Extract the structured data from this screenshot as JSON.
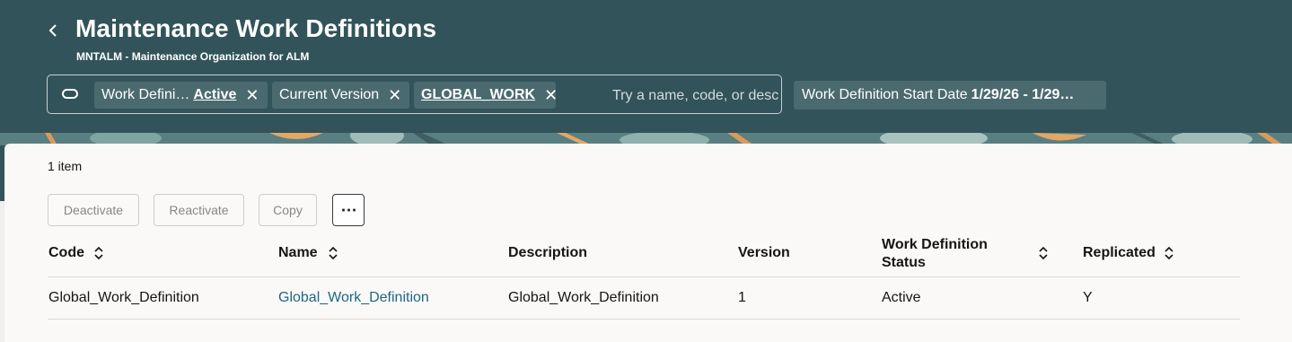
{
  "header": {
    "title": "Maintenance Work Definitions",
    "subtitle": "MNTALM - Maintenance Organization for ALM"
  },
  "search": {
    "placeholder": "Try a name, code, or description",
    "filters": [
      {
        "label": "Work Defini…",
        "value": "Active"
      },
      {
        "label": "Current Version",
        "value": ""
      },
      {
        "label": "",
        "value": "GLOBAL_WORK"
      }
    ],
    "date_filter": {
      "label": "Work Definition Start Date",
      "value": "1/29/26 - 1/29…"
    }
  },
  "results": {
    "count_text": "1 item"
  },
  "toolbar": {
    "deactivate": "Deactivate",
    "reactivate": "Reactivate",
    "copy": "Copy",
    "more": "⋯"
  },
  "table": {
    "columns": [
      "Code",
      "Name",
      "Description",
      "Version",
      "Work Definition Status",
      "Replicated"
    ],
    "rows": [
      {
        "code": "Global_Work_Definition",
        "name": "Global_Work_Definition",
        "description": "Global_Work_Definition",
        "version": "1",
        "status": "Active",
        "replicated": "Y"
      }
    ]
  },
  "colors": {
    "header_bg": "#32535a",
    "chip_bg": "#4a6a70",
    "link": "#1e6680"
  }
}
